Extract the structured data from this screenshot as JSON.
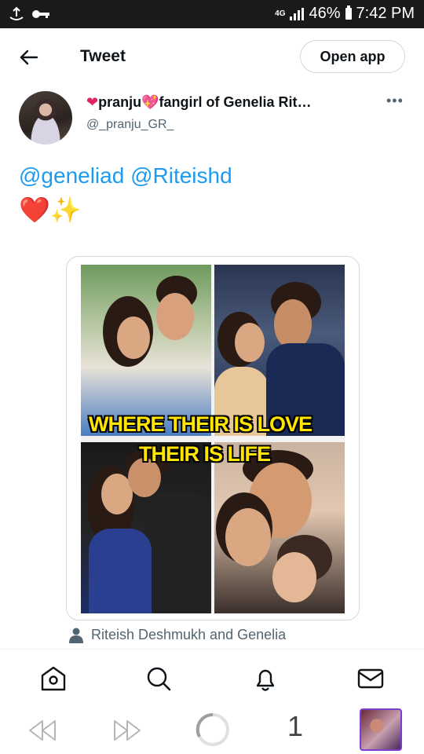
{
  "status_bar": {
    "network": "4G",
    "battery": "46%",
    "time": "7:42 PM"
  },
  "header": {
    "title": "Tweet",
    "open_app": "Open app"
  },
  "author": {
    "name_part1": "pranju",
    "name_part2": "fangirl of Genelia Rit…",
    "handle": "@_pranju_GR_"
  },
  "tweet": {
    "mention1": "@geneliad",
    "mention2": "@Riteishd",
    "emojis": "❤️✨"
  },
  "media": {
    "caption_line1": "WHERE THEIR IS LOVE",
    "caption_line2": "THEIR IS LIFE"
  },
  "tagged": "Riteish Deshmukh and Genelia",
  "browser": {
    "tab_count": "1"
  },
  "icons": [
    "back-arrow-icon",
    "more-icon",
    "home-icon",
    "search-icon",
    "notifications-icon",
    "messages-icon",
    "back-icon",
    "forward-icon",
    "loading-icon",
    "person-icon"
  ],
  "colors": {
    "link": "#1d9bf0",
    "secondary_text": "#536471",
    "heart": "#e0245e",
    "caption": "#ffe500"
  }
}
